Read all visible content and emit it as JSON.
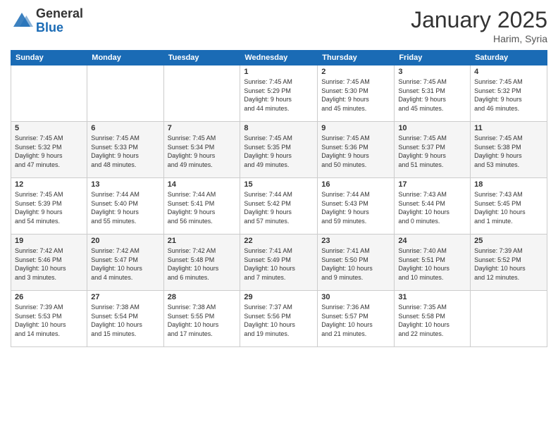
{
  "header": {
    "logo_general": "General",
    "logo_blue": "Blue",
    "month_title": "January 2025",
    "location": "Harim, Syria"
  },
  "days_of_week": [
    "Sunday",
    "Monday",
    "Tuesday",
    "Wednesday",
    "Thursday",
    "Friday",
    "Saturday"
  ],
  "weeks": [
    [
      {
        "day": "",
        "info": ""
      },
      {
        "day": "",
        "info": ""
      },
      {
        "day": "",
        "info": ""
      },
      {
        "day": "1",
        "info": "Sunrise: 7:45 AM\nSunset: 5:29 PM\nDaylight: 9 hours\nand 44 minutes."
      },
      {
        "day": "2",
        "info": "Sunrise: 7:45 AM\nSunset: 5:30 PM\nDaylight: 9 hours\nand 45 minutes."
      },
      {
        "day": "3",
        "info": "Sunrise: 7:45 AM\nSunset: 5:31 PM\nDaylight: 9 hours\nand 45 minutes."
      },
      {
        "day": "4",
        "info": "Sunrise: 7:45 AM\nSunset: 5:32 PM\nDaylight: 9 hours\nand 46 minutes."
      }
    ],
    [
      {
        "day": "5",
        "info": "Sunrise: 7:45 AM\nSunset: 5:32 PM\nDaylight: 9 hours\nand 47 minutes."
      },
      {
        "day": "6",
        "info": "Sunrise: 7:45 AM\nSunset: 5:33 PM\nDaylight: 9 hours\nand 48 minutes."
      },
      {
        "day": "7",
        "info": "Sunrise: 7:45 AM\nSunset: 5:34 PM\nDaylight: 9 hours\nand 49 minutes."
      },
      {
        "day": "8",
        "info": "Sunrise: 7:45 AM\nSunset: 5:35 PM\nDaylight: 9 hours\nand 49 minutes."
      },
      {
        "day": "9",
        "info": "Sunrise: 7:45 AM\nSunset: 5:36 PM\nDaylight: 9 hours\nand 50 minutes."
      },
      {
        "day": "10",
        "info": "Sunrise: 7:45 AM\nSunset: 5:37 PM\nDaylight: 9 hours\nand 51 minutes."
      },
      {
        "day": "11",
        "info": "Sunrise: 7:45 AM\nSunset: 5:38 PM\nDaylight: 9 hours\nand 53 minutes."
      }
    ],
    [
      {
        "day": "12",
        "info": "Sunrise: 7:45 AM\nSunset: 5:39 PM\nDaylight: 9 hours\nand 54 minutes."
      },
      {
        "day": "13",
        "info": "Sunrise: 7:44 AM\nSunset: 5:40 PM\nDaylight: 9 hours\nand 55 minutes."
      },
      {
        "day": "14",
        "info": "Sunrise: 7:44 AM\nSunset: 5:41 PM\nDaylight: 9 hours\nand 56 minutes."
      },
      {
        "day": "15",
        "info": "Sunrise: 7:44 AM\nSunset: 5:42 PM\nDaylight: 9 hours\nand 57 minutes."
      },
      {
        "day": "16",
        "info": "Sunrise: 7:44 AM\nSunset: 5:43 PM\nDaylight: 9 hours\nand 59 minutes."
      },
      {
        "day": "17",
        "info": "Sunrise: 7:43 AM\nSunset: 5:44 PM\nDaylight: 10 hours\nand 0 minutes."
      },
      {
        "day": "18",
        "info": "Sunrise: 7:43 AM\nSunset: 5:45 PM\nDaylight: 10 hours\nand 1 minute."
      }
    ],
    [
      {
        "day": "19",
        "info": "Sunrise: 7:42 AM\nSunset: 5:46 PM\nDaylight: 10 hours\nand 3 minutes."
      },
      {
        "day": "20",
        "info": "Sunrise: 7:42 AM\nSunset: 5:47 PM\nDaylight: 10 hours\nand 4 minutes."
      },
      {
        "day": "21",
        "info": "Sunrise: 7:42 AM\nSunset: 5:48 PM\nDaylight: 10 hours\nand 6 minutes."
      },
      {
        "day": "22",
        "info": "Sunrise: 7:41 AM\nSunset: 5:49 PM\nDaylight: 10 hours\nand 7 minutes."
      },
      {
        "day": "23",
        "info": "Sunrise: 7:41 AM\nSunset: 5:50 PM\nDaylight: 10 hours\nand 9 minutes."
      },
      {
        "day": "24",
        "info": "Sunrise: 7:40 AM\nSunset: 5:51 PM\nDaylight: 10 hours\nand 10 minutes."
      },
      {
        "day": "25",
        "info": "Sunrise: 7:39 AM\nSunset: 5:52 PM\nDaylight: 10 hours\nand 12 minutes."
      }
    ],
    [
      {
        "day": "26",
        "info": "Sunrise: 7:39 AM\nSunset: 5:53 PM\nDaylight: 10 hours\nand 14 minutes."
      },
      {
        "day": "27",
        "info": "Sunrise: 7:38 AM\nSunset: 5:54 PM\nDaylight: 10 hours\nand 15 minutes."
      },
      {
        "day": "28",
        "info": "Sunrise: 7:38 AM\nSunset: 5:55 PM\nDaylight: 10 hours\nand 17 minutes."
      },
      {
        "day": "29",
        "info": "Sunrise: 7:37 AM\nSunset: 5:56 PM\nDaylight: 10 hours\nand 19 minutes."
      },
      {
        "day": "30",
        "info": "Sunrise: 7:36 AM\nSunset: 5:57 PM\nDaylight: 10 hours\nand 21 minutes."
      },
      {
        "day": "31",
        "info": "Sunrise: 7:35 AM\nSunset: 5:58 PM\nDaylight: 10 hours\nand 22 minutes."
      },
      {
        "day": "",
        "info": ""
      }
    ]
  ]
}
